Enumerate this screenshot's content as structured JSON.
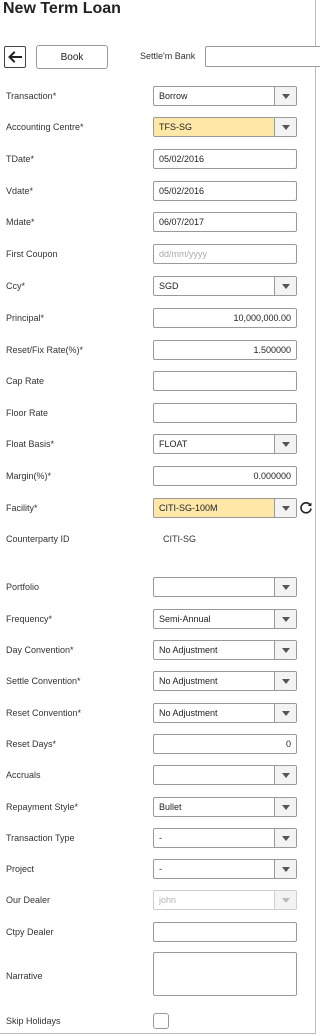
{
  "header": {
    "title": "New Term Loan",
    "book_label": "Book",
    "settle_label": "Settle'm Bank",
    "settle_value": ""
  },
  "fields": [
    {
      "key": "transaction",
      "label": "Transaction*",
      "type": "select",
      "value": "Borrow"
    },
    {
      "key": "accounting_centre",
      "label": "Accounting Centre*",
      "type": "select",
      "value": "TFS-SG",
      "highlight": true
    },
    {
      "key": "tdate",
      "label": "TDate*",
      "type": "text",
      "value": "05/02/2016"
    },
    {
      "key": "vdate",
      "label": "Vdate*",
      "type": "text",
      "value": "05/02/2016"
    },
    {
      "key": "mdate",
      "label": "Mdate*",
      "type": "text",
      "value": "06/07/2017"
    },
    {
      "key": "first_coupon",
      "label": "First Coupon",
      "type": "text",
      "value": "",
      "placeholder": "dd/mm/yyyy"
    },
    {
      "key": "ccy",
      "label": "Ccy*",
      "type": "select",
      "value": "SGD"
    },
    {
      "key": "principal",
      "label": "Principal*",
      "type": "number",
      "value": "10,000,000.00"
    },
    {
      "key": "reset_fix_rate",
      "label": "Reset/Fix Rate(%)*",
      "type": "number",
      "value": "1.500000"
    },
    {
      "key": "cap_rate",
      "label": "Cap Rate",
      "type": "text",
      "value": ""
    },
    {
      "key": "floor_rate",
      "label": "Floor Rate",
      "type": "text",
      "value": ""
    },
    {
      "key": "float_basis",
      "label": "Float Basis*",
      "type": "select",
      "value": "FLOAT"
    },
    {
      "key": "margin",
      "label": "Margin(%)*",
      "type": "number",
      "value": "0.000000"
    },
    {
      "key": "facility",
      "label": "Facility*",
      "type": "select",
      "value": "CITI-SG-100M",
      "highlight": true
    },
    {
      "key": "counterparty_id",
      "label": "Counterparty ID",
      "type": "static",
      "value": "CITI-SG"
    },
    {
      "key": "portfolio",
      "label": "Portfolio",
      "type": "select",
      "value": ""
    },
    {
      "key": "frequency",
      "label": "Frequency*",
      "type": "select",
      "value": "Semi-Annual"
    },
    {
      "key": "day_convention",
      "label": "Day Convention*",
      "type": "select",
      "value": "No Adjustment"
    },
    {
      "key": "settle_convention",
      "label": "Settle Convention*",
      "type": "select",
      "value": "No Adjustment"
    },
    {
      "key": "reset_convention",
      "label": "Reset Convention*",
      "type": "select",
      "value": "No Adjustment"
    },
    {
      "key": "reset_days",
      "label": "Reset Days*",
      "type": "number",
      "value": "0"
    },
    {
      "key": "accruals",
      "label": "Accruals",
      "type": "select",
      "value": ""
    },
    {
      "key": "repayment_style",
      "label": "Repayment Style*",
      "type": "select",
      "value": "Bullet"
    },
    {
      "key": "transaction_type",
      "label": "Transaction Type",
      "type": "select",
      "value": "-"
    },
    {
      "key": "project",
      "label": "Project",
      "type": "select",
      "value": "-"
    },
    {
      "key": "our_dealer",
      "label": "Our Dealer",
      "type": "select",
      "value": "john",
      "disabled": true
    },
    {
      "key": "ctpy_dealer",
      "label": "Ctpy Dealer",
      "type": "text",
      "value": ""
    },
    {
      "key": "narrative",
      "label": "Narrative",
      "type": "textarea",
      "value": ""
    },
    {
      "key": "skip_holidays",
      "label": "Skip Holidays",
      "type": "checkbox",
      "value": ""
    }
  ],
  "icons": {
    "back": "arrow-left-icon",
    "refresh": "refresh-icon",
    "dropdown": "chevron-down-icon"
  },
  "colors": {
    "highlight": "#fde8a8",
    "border": "#9a9a9a"
  }
}
